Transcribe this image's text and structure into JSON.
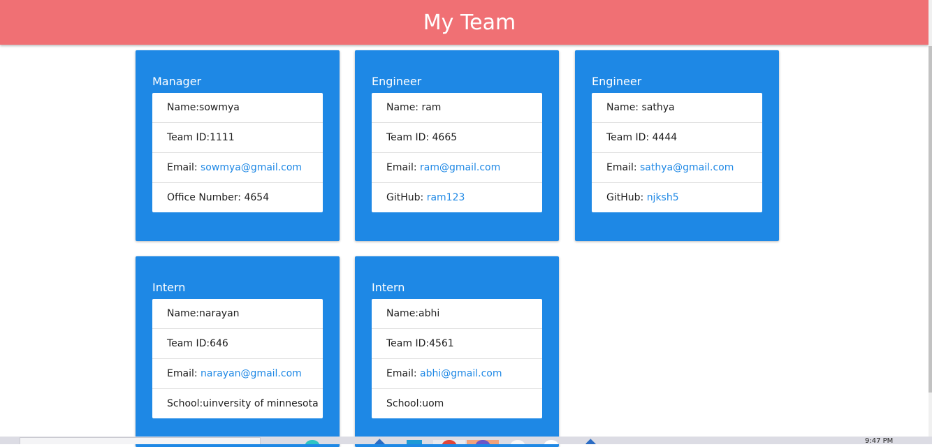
{
  "header": {
    "title": "My Team"
  },
  "cards": [
    {
      "role": "Manager",
      "name_line": "Name:sowmya",
      "id_line": "Team ID:1111",
      "email_label": "Email: ",
      "email": "sowmya@gmail.com",
      "extra_label": "Office Number: 4654",
      "extra_link": ""
    },
    {
      "role": "Engineer",
      "name_line": "Name: ram",
      "id_line": "Team ID: 4665",
      "email_label": "Email: ",
      "email": "ram@gmail.com",
      "extra_label": "GitHub: ",
      "extra_link": "ram123"
    },
    {
      "role": "Engineer",
      "name_line": "Name: sathya",
      "id_line": "Team ID: 4444",
      "email_label": "Email: ",
      "email": "sathya@gmail.com",
      "extra_label": "GitHub: ",
      "extra_link": "njksh5"
    },
    {
      "role": "Intern",
      "name_line": "Name:narayan",
      "id_line": "Team ID:646",
      "email_label": "Email: ",
      "email": "narayan@gmail.com",
      "extra_label": "School:uinversity of minnesota",
      "extra_link": ""
    },
    {
      "role": "Intern",
      "name_line": "Name:abhi",
      "id_line": "Team ID:4561",
      "email_label": "Email: ",
      "email": "abhi@gmail.com",
      "extra_label": "School:uom",
      "extra_link": ""
    }
  ],
  "taskbar": {
    "clock": "9:47 PM"
  },
  "colors": {
    "header_bg": "#f07074",
    "card_bg": "#1e88e5",
    "link": "#1e88e5"
  }
}
